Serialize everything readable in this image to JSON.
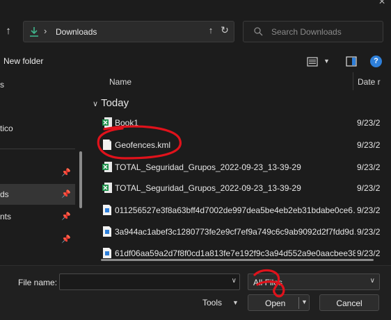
{
  "titlebar": {
    "close_icon": "close-icon"
  },
  "nav": {
    "up_icon": "arrow-up-icon",
    "address": {
      "folder": "Downloads",
      "chevron": "›",
      "folder_icon": "download-arrow-icon",
      "up_icon": "arrow-up-icon",
      "refresh_icon": "refresh-icon"
    },
    "search": {
      "placeholder": "Search Downloads",
      "icon": "search-icon"
    }
  },
  "toolbar": {
    "new_folder": "New folder",
    "view_icon": "list-view-icon",
    "preview_icon": "preview-pane-icon",
    "help_icon": "help-icon",
    "help_glyph": "?"
  },
  "sidebar": {
    "items": [
      {
        "label": "s",
        "pinned": false,
        "selected": false
      },
      {
        "label": "tico",
        "pinned": false,
        "selected": false
      },
      {
        "label": "",
        "pinned": true,
        "selected": false
      },
      {
        "label": "ds",
        "pinned": true,
        "selected": true
      },
      {
        "label": "nts",
        "pinned": true,
        "selected": false
      },
      {
        "label": "",
        "pinned": true,
        "selected": false
      }
    ]
  },
  "list": {
    "columns": {
      "name": "Name",
      "date": "Date r"
    },
    "group": "Today",
    "rows": [
      {
        "name": "Book1",
        "date": "9/23/2",
        "icon": "excel-file-icon"
      },
      {
        "name": "Geofences.kml",
        "date": "9/23/2",
        "icon": "document-file-icon"
      },
      {
        "name": "TOTAL_Seguridad_Grupos_2022-09-23_13-39-29",
        "date": "9/23/2",
        "icon": "excel-file-icon"
      },
      {
        "name": "TOTAL_Seguridad_Grupos_2022-09-23_13-39-29",
        "date": "9/23/2",
        "icon": "excel-file-icon"
      },
      {
        "name": "011256527e3f8a63bff4d7002de997dea5be4eb2eb31bdabe0ce6…",
        "date": "9/23/2",
        "icon": "image-file-icon"
      },
      {
        "name": "3a944ac1abef3c1280773fe2e9cf7ef9a749c6c9ab9092d2f7fdd9d…",
        "date": "9/23/2",
        "icon": "image-file-icon"
      },
      {
        "name": "61df06aa59a2d7f8f0cd1a813fe7e192f9c3a94d552a9e0aacbee38…",
        "date": "9/23/2",
        "icon": "image-file-icon"
      }
    ]
  },
  "footer": {
    "file_name_label": "File name:",
    "file_name_value": "",
    "file_type": "All Files",
    "tools": "Tools",
    "open": "Open",
    "cancel": "Cancel"
  },
  "colors": {
    "background": "#1c1c1c",
    "accent": "#2e7fd9",
    "annotation": "#e0121b",
    "excel_green": "#1d8f4a"
  }
}
